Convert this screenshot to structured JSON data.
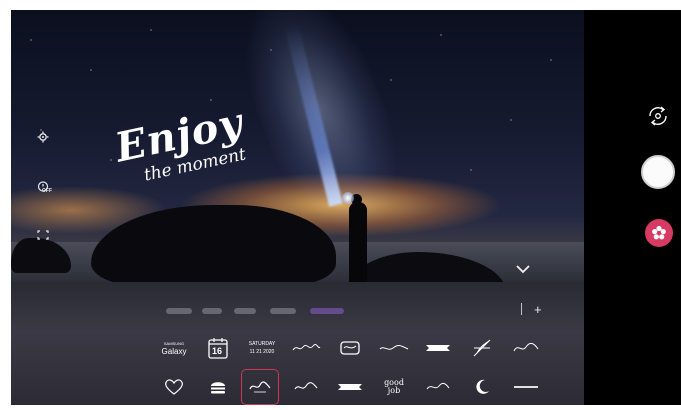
{
  "overlay": {
    "line1": "Enjoy",
    "line2": "the moment"
  },
  "left_controls": [
    {
      "icon": "gear-icon"
    },
    {
      "icon": "timer-off-icon",
      "label": "OFF"
    },
    {
      "icon": "aspect-ratio-icon"
    }
  ],
  "stickers_row1": [
    {
      "line1": "SAMSUNG",
      "line2": "Galaxy"
    },
    {
      "icon": "calendar-icon",
      "text": "16"
    },
    {
      "line1": "SATURDAY",
      "line2": "11 21 2020"
    },
    {
      "icon": "script-sticker-icon"
    },
    {
      "icon": "badge-sticker-icon"
    },
    {
      "icon": "script-sticker-icon"
    },
    {
      "icon": "banner-sticker-icon"
    },
    {
      "icon": "feather-sticker-icon"
    },
    {
      "icon": "script-sticker-icon"
    }
  ],
  "stickers_row2": [
    {
      "icon": "heart-sticker-icon"
    },
    {
      "icon": "burger-sticker-icon"
    },
    {
      "icon": "enjoy-sticker-icon",
      "selected": true
    },
    {
      "icon": "script-sticker-icon"
    },
    {
      "icon": "ribbon-sticker-icon"
    },
    {
      "line1": "good",
      "line2": "job"
    },
    {
      "icon": "script-sticker-icon"
    },
    {
      "icon": "moon-sticker-icon"
    },
    {
      "icon": "text-sticker-icon"
    }
  ],
  "right_controls": {
    "flip_icon": "switch-camera-icon",
    "shutter_icon": "shutter-icon",
    "sticker_icon": "sticker-button-icon",
    "accent_color": "#d73a63"
  }
}
